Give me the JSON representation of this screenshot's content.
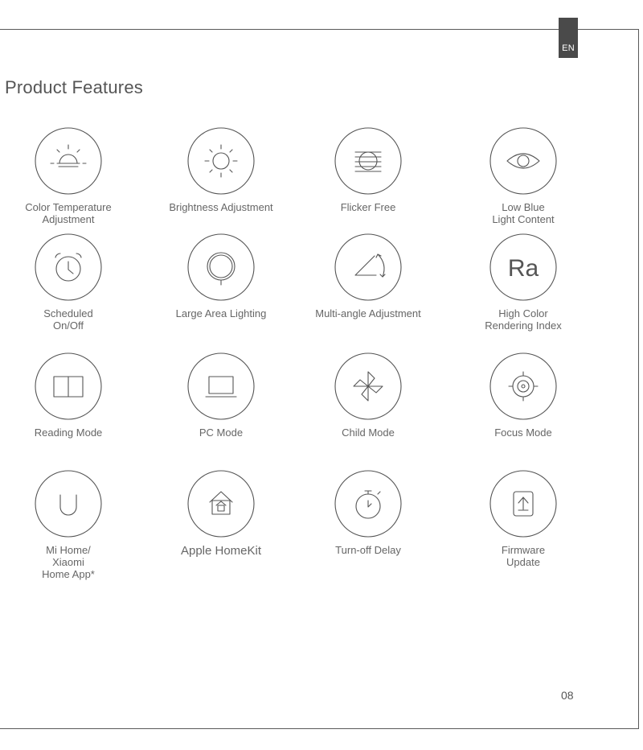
{
  "lang_tab": "EN",
  "title": "Product Features",
  "page_number": "08",
  "features": [
    {
      "label": "Color  Temperature\nAdjustment",
      "icon": "sunrise-icon"
    },
    {
      "label": "Brightness Adjustment",
      "icon": "sun-icon"
    },
    {
      "label": "Flicker Free",
      "icon": "flicker-free-icon"
    },
    {
      "label": "Low Blue\nLight Content",
      "icon": "eye-icon"
    },
    {
      "label": "Scheduled\nOn/Off",
      "icon": "alarm-clock-icon"
    },
    {
      "label": "Large Area Lighting",
      "icon": "ring-light-icon"
    },
    {
      "label": "Multi-angle Adjustment",
      "icon": "angle-icon"
    },
    {
      "label": "High Color\nRendering Index",
      "icon": "ra-icon"
    },
    {
      "label": "Reading Mode",
      "icon": "book-icon"
    },
    {
      "label": "PC Mode",
      "icon": "laptop-icon"
    },
    {
      "label": "Child Mode",
      "icon": "pinwheel-icon"
    },
    {
      "label": "Focus Mode",
      "icon": "target-icon"
    },
    {
      "label": "Mi Home/\nXiaomi\nHome App*",
      "icon": "mi-home-icon"
    },
    {
      "label": "Apple HomeKit",
      "icon": "homekit-icon"
    },
    {
      "label": "Turn-off Delay",
      "icon": "timer-icon"
    },
    {
      "label": "Firmware\nUpdate",
      "icon": "firmware-update-icon"
    }
  ]
}
